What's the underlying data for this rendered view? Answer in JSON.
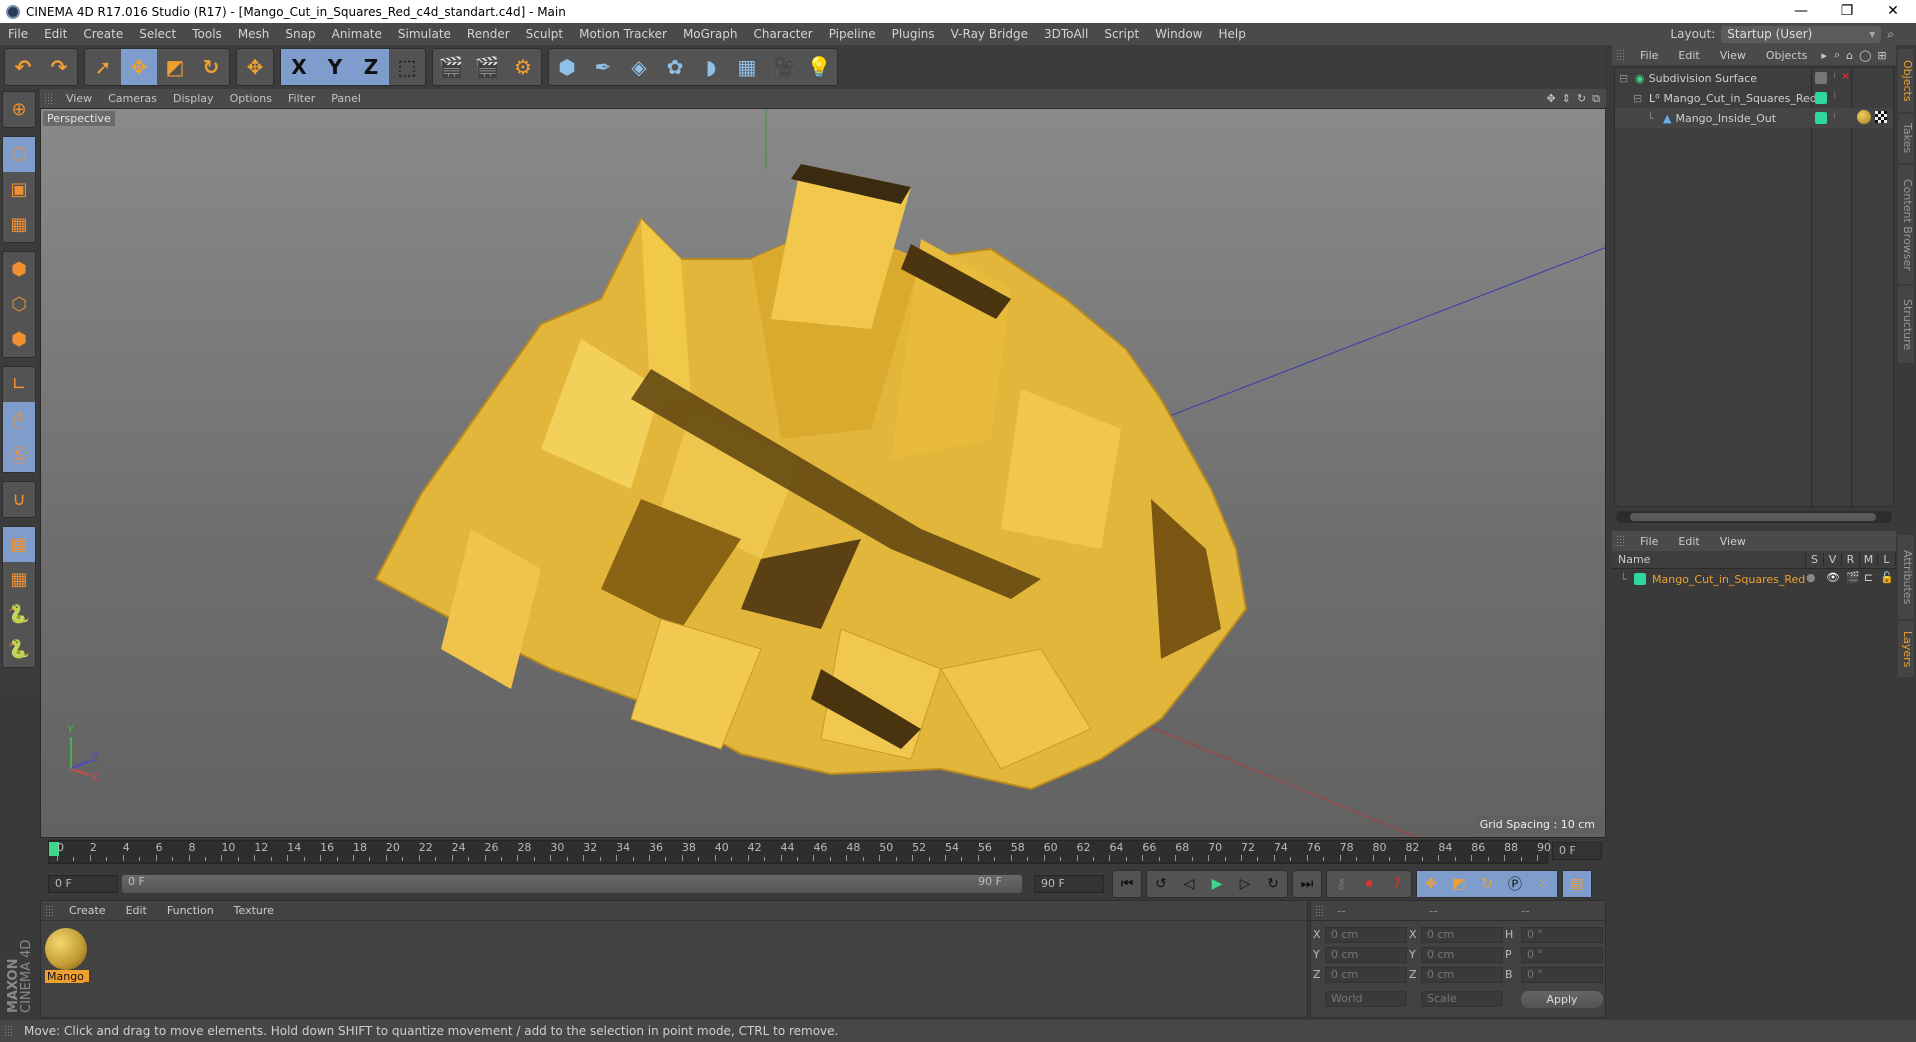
{
  "window": {
    "title": "CINEMA 4D R17.016 Studio (R17) - [Mango_Cut_in_Squares_Red_c4d_standart.c4d] - Main",
    "controls": {
      "minimize": "—",
      "maximize": "❐",
      "close": "✕"
    }
  },
  "menubar": [
    "File",
    "Edit",
    "Create",
    "Select",
    "Tools",
    "Mesh",
    "Snap",
    "Animate",
    "Simulate",
    "Render",
    "Sculpt",
    "Motion Tracker",
    "MoGraph",
    "Character",
    "Pipeline",
    "Plugins",
    "V-Ray Bridge",
    "3DToAll",
    "Script",
    "Window",
    "Help"
  ],
  "layout": {
    "label": "Layout:",
    "value": "Startup (User)"
  },
  "toolbar": {
    "groups": [
      [
        "undo-icon",
        "redo-icon"
      ],
      [
        "select-arrow-icon",
        "move-icon",
        "scale-icon",
        "rotate-icon"
      ],
      [
        "move-alt-icon"
      ],
      [
        "x-axis-icon",
        "y-axis-icon",
        "z-axis-icon",
        "world-coord-icon"
      ],
      [
        "render-view-icon",
        "render-picture-viewer-icon",
        "render-settings-icon"
      ],
      [
        "cube-icon",
        "pen-icon",
        "subdivision-icon",
        "array-icon",
        "deformer-icon",
        "floor-icon",
        "camera-icon",
        "light-icon"
      ]
    ],
    "glyphs": {
      "undo-icon": "↶",
      "redo-icon": "↷",
      "select-arrow-icon": "➚",
      "move-icon": "✥",
      "scale-icon": "◩",
      "rotate-icon": "↻",
      "move-alt-icon": "✥",
      "x-axis-icon": "X",
      "y-axis-icon": "Y",
      "z-axis-icon": "Z",
      "world-coord-icon": "⬚",
      "render-view-icon": "🎬",
      "render-picture-viewer-icon": "🎬",
      "render-settings-icon": "⚙",
      "cube-icon": "⬢",
      "pen-icon": "✒",
      "subdivision-icon": "◈",
      "array-icon": "✿",
      "deformer-icon": "◗",
      "floor-icon": "▦",
      "camera-icon": "🎥",
      "light-icon": "💡"
    }
  },
  "left_tools": [
    [
      "model-mode-icon"
    ],
    [
      "object-mode-icon",
      "texture-mode-icon",
      "workplane-icon"
    ],
    [
      "points-mode-icon",
      "edges-mode-icon",
      "polygons-mode-icon"
    ],
    [
      "axis-mode-icon",
      "tweak-mode-icon",
      "snap-s-icon"
    ],
    [
      "magnet-icon"
    ],
    [
      "locked-workplane-icon",
      "workplane-align-icon",
      "python-icon",
      "python-alt-icon"
    ]
  ],
  "viewport": {
    "menu": [
      "View",
      "Cameras",
      "Display",
      "Options",
      "Filter",
      "Panel"
    ],
    "label": "Perspective",
    "grid_spacing": "Grid Spacing : 10 cm",
    "axis_labels": {
      "x": "X",
      "y": "Y",
      "z": "Z"
    }
  },
  "objects_panel": {
    "menu": [
      "File",
      "Edit",
      "View",
      "Objects"
    ],
    "items": [
      {
        "name": "Subdivision Surface",
        "indent": 0,
        "icon": "subdivision-icon"
      },
      {
        "name": "Mango_Cut_in_Squares_Red",
        "indent": 1,
        "icon": "null-object-icon"
      },
      {
        "name": "Mango_Inside_Out",
        "indent": 2,
        "icon": "polygon-object-icon"
      }
    ]
  },
  "layers_panel": {
    "menu": [
      "File",
      "Edit",
      "View"
    ],
    "columns": [
      "Name",
      "S",
      "V",
      "R",
      "M",
      "L"
    ],
    "rows": [
      {
        "name": "Mango_Cut_in_Squares_Red",
        "color": "#2ed6a0"
      }
    ]
  },
  "side_tabs": {
    "top": [
      "Objects",
      "Takes",
      "Content Browser",
      "Structure"
    ],
    "bottom": [
      "Attributes",
      "Layers"
    ]
  },
  "timeline": {
    "ticks": [
      "0",
      "2",
      "4",
      "6",
      "8",
      "10",
      "12",
      "14",
      "16",
      "18",
      "20",
      "22",
      "24",
      "26",
      "28",
      "30",
      "32",
      "34",
      "36",
      "38",
      "40",
      "42",
      "44",
      "46",
      "48",
      "50",
      "52",
      "54",
      "56",
      "58",
      "60",
      "62",
      "64",
      "66",
      "68",
      "70",
      "72",
      "74",
      "76",
      "78",
      "80",
      "82",
      "84",
      "86",
      "88",
      "90"
    ],
    "current_frame": "0 F",
    "start_field": "0 F",
    "range_start": "0 F",
    "range_end": "90 F",
    "end_field": "90 F",
    "playhead_fraction": 0
  },
  "transport": [
    "go-start-icon",
    "prev-key-icon",
    "step-back-icon",
    "play-icon",
    "step-forward-icon",
    "next-key-icon",
    "go-end-icon"
  ],
  "transport_glyphs": {
    "go-start-icon": "⏮",
    "prev-key-icon": "◀",
    "step-back-icon": "◁",
    "play-icon": "▶",
    "step-forward-icon": "▷",
    "next-key-icon": "↻",
    "go-end-icon": "⏭"
  },
  "record_tools": [
    "keyframe-selection-icon",
    "autokey-icon",
    "record-help-icon"
  ],
  "key_tools": [
    "key-move-icon",
    "key-scale-icon",
    "key-rotate-icon",
    "key-param-icon",
    "key-pla-icon",
    "timeline-icon"
  ],
  "material_panel": {
    "menu": [
      "Create",
      "Edit",
      "Function",
      "Texture"
    ],
    "materials": [
      {
        "name": "Mango_"
      }
    ],
    "brand_top": "MAXON",
    "brand_bottom": "CINEMA 4D"
  },
  "coordinates": {
    "headers": [
      "--",
      "--",
      "--"
    ],
    "rows": [
      {
        "l1": "X",
        "v1": "0 cm",
        "l2": "X",
        "v2": "0 cm",
        "l3": "H",
        "v3": "0 °"
      },
      {
        "l1": "Y",
        "v1": "0 cm",
        "l2": "Y",
        "v2": "0 cm",
        "l3": "P",
        "v3": "0 °"
      },
      {
        "l1": "Z",
        "v1": "0 cm",
        "l2": "Z",
        "v2": "0 cm",
        "l3": "B",
        "v3": "0 °"
      }
    ],
    "space": "World",
    "mode": "Scale",
    "apply": "Apply"
  },
  "status": "Move: Click and drag to move elements. Hold down SHIFT to quantize movement / add to the selection in point mode, CTRL to remove."
}
